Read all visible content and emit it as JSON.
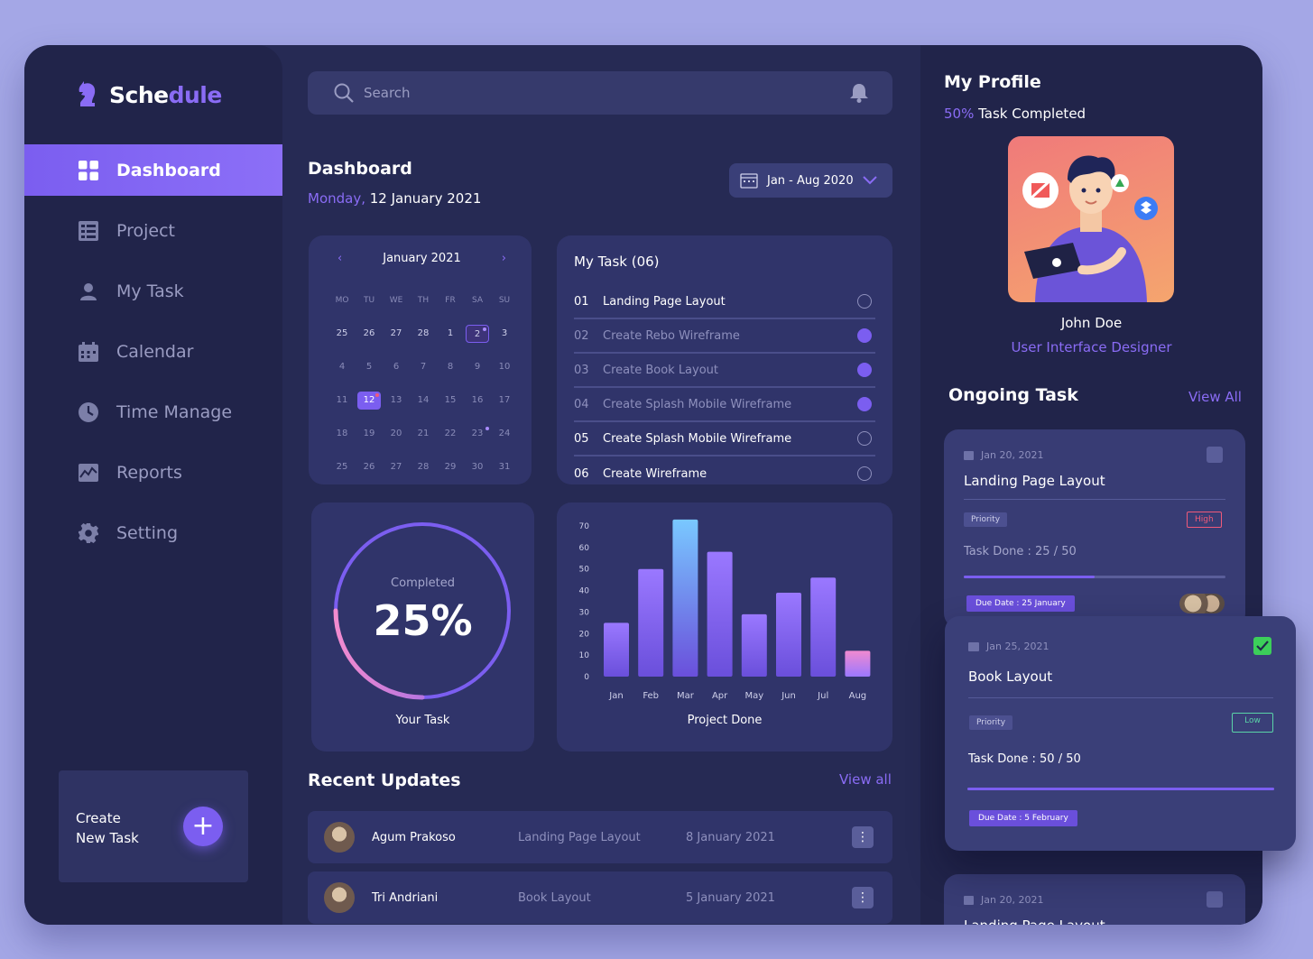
{
  "app": {
    "name_a": "Sche",
    "name_b": "dule"
  },
  "sidebar": {
    "items": [
      {
        "label": "Dashboard",
        "icon": "grid-icon",
        "active": true
      },
      {
        "label": "Project",
        "icon": "list-icon"
      },
      {
        "label": "My Task",
        "icon": "user-icon"
      },
      {
        "label": "Calendar",
        "icon": "calendar-icon"
      },
      {
        "label": "Time Manage",
        "icon": "clock-icon"
      },
      {
        "label": "Reports",
        "icon": "chart-icon"
      },
      {
        "label": "Setting",
        "icon": "gear-icon"
      }
    ],
    "create": {
      "line1": "Create",
      "line2": "New Task",
      "button": "+"
    }
  },
  "search": {
    "placeholder": "Search"
  },
  "header": {
    "title": "Dashboard",
    "day": "Monday,",
    "date": " 12 January 2021",
    "range": "Jan - Aug 2020"
  },
  "calendar": {
    "month": "January 2021",
    "prev": "‹",
    "next": "›",
    "weekdays": [
      "MO",
      "TU",
      "WE",
      "TH",
      "FR",
      "SA",
      "SU"
    ],
    "days": [
      [
        "25",
        "26",
        "27",
        "28",
        "1",
        "2",
        "3"
      ],
      [
        "4",
        "5",
        "6",
        "7",
        "8",
        "9",
        "10"
      ],
      [
        "11",
        "12",
        "13",
        "14",
        "15",
        "16",
        "17"
      ],
      [
        "18",
        "19",
        "20",
        "21",
        "22",
        "23",
        "24"
      ],
      [
        "25",
        "26",
        "27",
        "28",
        "29",
        "30",
        "31"
      ]
    ],
    "selected": "12",
    "marked": "2"
  },
  "my_task": {
    "title": "My Task (06)",
    "items": [
      {
        "num": "01",
        "label": "Landing Page Layout",
        "done": false
      },
      {
        "num": "02",
        "label": "Create Rebo Wireframe",
        "done": true
      },
      {
        "num": "03",
        "label": "Create Book Layout",
        "done": true
      },
      {
        "num": "04",
        "label": "Create Splash Mobile Wireframe",
        "done": true
      },
      {
        "num": "05",
        "label": "Create Splash Mobile Wireframe",
        "done": false
      },
      {
        "num": "06",
        "label": "Create Wireframe",
        "done": false
      }
    ]
  },
  "progress": {
    "label": "Completed",
    "value": "25%",
    "fraction": 0.25,
    "caption": "Your Task"
  },
  "chart_data": {
    "type": "bar",
    "categories": [
      "Jan",
      "Feb",
      "Mar",
      "Apr",
      "May",
      "Jun",
      "Jul",
      "Aug"
    ],
    "values": [
      25,
      50,
      73,
      58,
      29,
      39,
      46,
      12
    ],
    "yticks": [
      "0",
      "10",
      "20",
      "30",
      "40",
      "50",
      "60",
      "70"
    ],
    "ylim": [
      0,
      70
    ],
    "xlabel": "Project Done",
    "colors": {
      "bar_top": "#9a78ff",
      "bar_bottom": "#6a4fdb",
      "highlight_top": "#79c8ff",
      "last_top": "#f08ad0"
    }
  },
  "recent": {
    "title": "Recent Updates",
    "view_all": "View all",
    "rows": [
      {
        "name": "Agum Prakoso",
        "project": "Landing Page Layout",
        "date": "8 January 2021",
        "menu": "⋮"
      },
      {
        "name": "Tri Andriani",
        "project": "Book Layout",
        "date": "5 January 2021",
        "menu": "⋮"
      }
    ]
  },
  "profile": {
    "title": "My Profile",
    "percent": "50%",
    "completed": " Task Completed",
    "name": "John Doe",
    "role": "User Interface Designer"
  },
  "ongoing": {
    "title": "Ongoing Task",
    "view_all": "View All",
    "cards": [
      {
        "date": "Jan 20, 2021",
        "title": "Landing Page Layout",
        "priority": "Priority",
        "level": "High",
        "done": "Task Done : 25 / 50",
        "progress": 0.5,
        "due": "Due Date : 25 January"
      },
      {
        "date": "Jan 25, 2021",
        "title": "Book Layout",
        "priority": "Priority",
        "level": "Low",
        "done": "Task Done : 50 / 50",
        "progress": 1.0,
        "due": "Due Date : 5 February"
      },
      {
        "date": "Jan 20, 2021",
        "title": "Landing Page Layout"
      }
    ]
  },
  "colors": {
    "accent": "#7b5ef0",
    "high": "#f05a7a",
    "low": "#5ad4a8",
    "check": "#3ccf5a"
  }
}
